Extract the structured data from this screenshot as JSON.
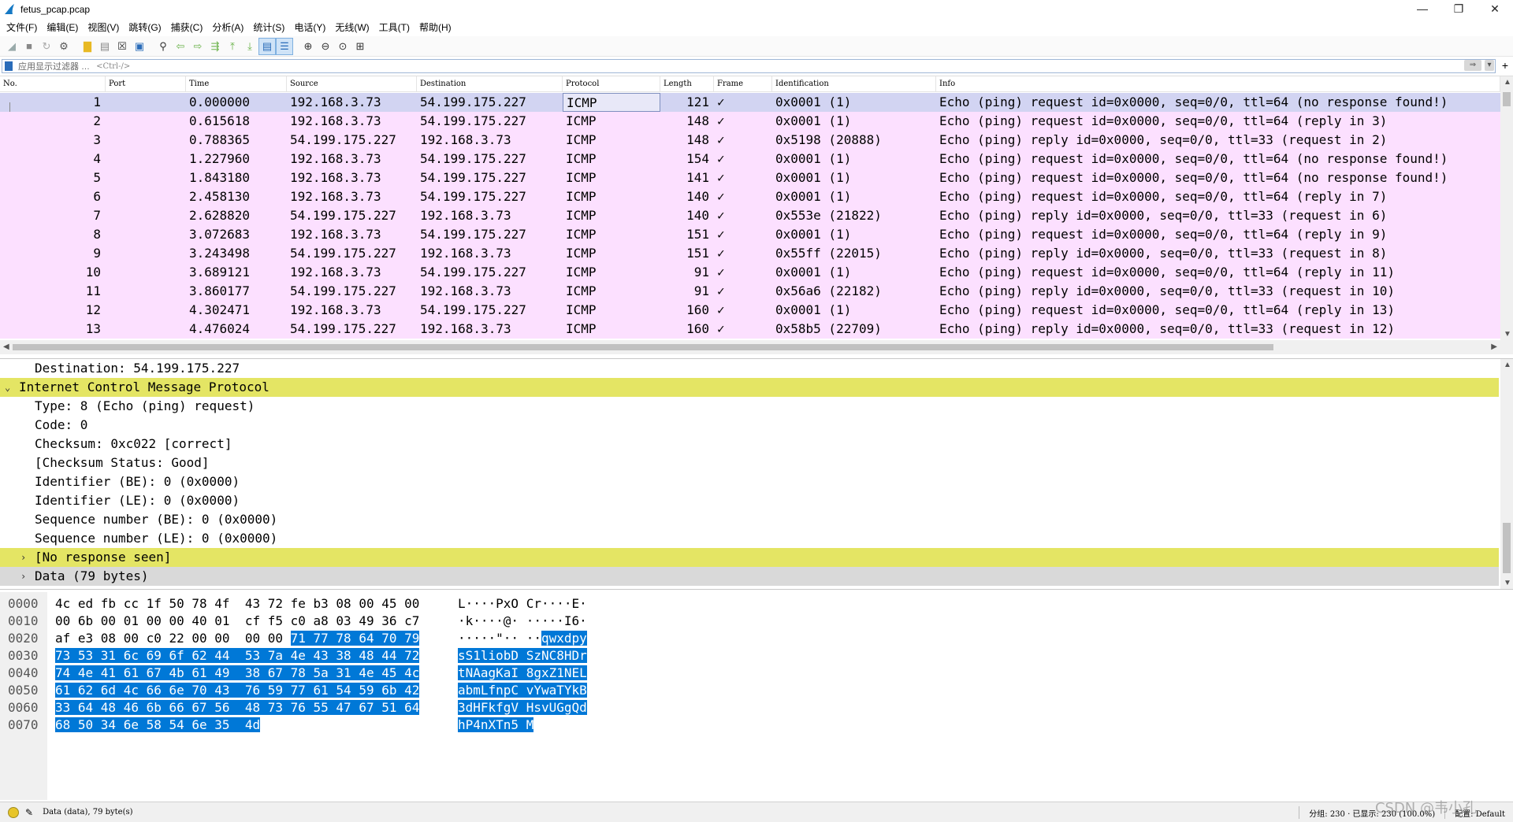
{
  "window": {
    "title": "fetus_pcap.pcap",
    "controls": [
      "—",
      "❐",
      "✕"
    ]
  },
  "menu": [
    "文件(F)",
    "编辑(E)",
    "视图(V)",
    "跳转(G)",
    "捕获(C)",
    "分析(A)",
    "统计(S)",
    "电话(Y)",
    "无线(W)",
    "工具(T)",
    "帮助(H)"
  ],
  "filter": {
    "placeholder": "应用显示过滤器 … <Ctrl-/>",
    "label": "应用显示过滤器 …",
    "hint": "<Ctrl-/>",
    "plus": "+"
  },
  "columns": [
    "No.",
    "Port",
    "Time",
    "Source",
    "Destination",
    "Protocol",
    "Length",
    "Frame",
    "Identification",
    "Info"
  ],
  "packets": [
    {
      "no": "1",
      "time": "0.000000",
      "src": "192.168.3.73",
      "dst": "54.199.175.227",
      "proto": "ICMP",
      "len": "121",
      "frame": "✓",
      "ident": "0x0001 (1)",
      "info": "Echo (ping) request  id=0x0000, seq=0/0, ttl=64 (no response found!)"
    },
    {
      "no": "2",
      "time": "0.615618",
      "src": "192.168.3.73",
      "dst": "54.199.175.227",
      "proto": "ICMP",
      "len": "148",
      "frame": "✓",
      "ident": "0x0001 (1)",
      "info": "Echo (ping) request  id=0x0000, seq=0/0, ttl=64 (reply in 3)"
    },
    {
      "no": "3",
      "time": "0.788365",
      "src": "54.199.175.227",
      "dst": "192.168.3.73",
      "proto": "ICMP",
      "len": "148",
      "frame": "✓",
      "ident": "0x5198 (20888)",
      "info": "Echo (ping) reply    id=0x0000, seq=0/0, ttl=33 (request in 2)"
    },
    {
      "no": "4",
      "time": "1.227960",
      "src": "192.168.3.73",
      "dst": "54.199.175.227",
      "proto": "ICMP",
      "len": "154",
      "frame": "✓",
      "ident": "0x0001 (1)",
      "info": "Echo (ping) request  id=0x0000, seq=0/0, ttl=64 (no response found!)"
    },
    {
      "no": "5",
      "time": "1.843180",
      "src": "192.168.3.73",
      "dst": "54.199.175.227",
      "proto": "ICMP",
      "len": "141",
      "frame": "✓",
      "ident": "0x0001 (1)",
      "info": "Echo (ping) request  id=0x0000, seq=0/0, ttl=64 (no response found!)"
    },
    {
      "no": "6",
      "time": "2.458130",
      "src": "192.168.3.73",
      "dst": "54.199.175.227",
      "proto": "ICMP",
      "len": "140",
      "frame": "✓",
      "ident": "0x0001 (1)",
      "info": "Echo (ping) request  id=0x0000, seq=0/0, ttl=64 (reply in 7)"
    },
    {
      "no": "7",
      "time": "2.628820",
      "src": "54.199.175.227",
      "dst": "192.168.3.73",
      "proto": "ICMP",
      "len": "140",
      "frame": "✓",
      "ident": "0x553e (21822)",
      "info": "Echo (ping) reply    id=0x0000, seq=0/0, ttl=33 (request in 6)"
    },
    {
      "no": "8",
      "time": "3.072683",
      "src": "192.168.3.73",
      "dst": "54.199.175.227",
      "proto": "ICMP",
      "len": "151",
      "frame": "✓",
      "ident": "0x0001 (1)",
      "info": "Echo (ping) request  id=0x0000, seq=0/0, ttl=64 (reply in 9)"
    },
    {
      "no": "9",
      "time": "3.243498",
      "src": "54.199.175.227",
      "dst": "192.168.3.73",
      "proto": "ICMP",
      "len": "151",
      "frame": "✓",
      "ident": "0x55ff (22015)",
      "info": "Echo (ping) reply    id=0x0000, seq=0/0, ttl=33 (request in 8)"
    },
    {
      "no": "10",
      "time": "3.689121",
      "src": "192.168.3.73",
      "dst": "54.199.175.227",
      "proto": "ICMP",
      "len": "91",
      "frame": "✓",
      "ident": "0x0001 (1)",
      "info": "Echo (ping) request  id=0x0000, seq=0/0, ttl=64 (reply in 11)"
    },
    {
      "no": "11",
      "time": "3.860177",
      "src": "54.199.175.227",
      "dst": "192.168.3.73",
      "proto": "ICMP",
      "len": "91",
      "frame": "✓",
      "ident": "0x56a6 (22182)",
      "info": "Echo (ping) reply    id=0x0000, seq=0/0, ttl=33 (request in 10)"
    },
    {
      "no": "12",
      "time": "4.302471",
      "src": "192.168.3.73",
      "dst": "54.199.175.227",
      "proto": "ICMP",
      "len": "160",
      "frame": "✓",
      "ident": "0x0001 (1)",
      "info": "Echo (ping) request  id=0x0000, seq=0/0, ttl=64 (reply in 13)"
    },
    {
      "no": "13",
      "time": "4.476024",
      "src": "54.199.175.227",
      "dst": "192.168.3.73",
      "proto": "ICMP",
      "len": "160",
      "frame": "✓",
      "ident": "0x58b5 (22709)",
      "info": "Echo (ping) reply    id=0x0000, seq=0/0, ttl=33 (request in 12)"
    }
  ],
  "details": [
    {
      "text": "Destination: 54.199.175.227",
      "level": 1,
      "toggle": "",
      "style": ""
    },
    {
      "text": "Internet Control Message Protocol",
      "level": 0,
      "toggle": "⌄",
      "style": "hl"
    },
    {
      "text": "Type: 8 (Echo (ping) request)",
      "level": 1,
      "toggle": "",
      "style": ""
    },
    {
      "text": "Code: 0",
      "level": 1,
      "toggle": "",
      "style": ""
    },
    {
      "text": "Checksum: 0xc022 [correct]",
      "level": 1,
      "toggle": "",
      "style": ""
    },
    {
      "text": "[Checksum Status: Good]",
      "level": 1,
      "toggle": "",
      "style": ""
    },
    {
      "text": "Identifier (BE): 0 (0x0000)",
      "level": 1,
      "toggle": "",
      "style": ""
    },
    {
      "text": "Identifier (LE): 0 (0x0000)",
      "level": 1,
      "toggle": "",
      "style": ""
    },
    {
      "text": "Sequence number (BE): 0 (0x0000)",
      "level": 1,
      "toggle": "",
      "style": ""
    },
    {
      "text": "Sequence number (LE): 0 (0x0000)",
      "level": 1,
      "toggle": "",
      "style": ""
    },
    {
      "text": "[No response seen]",
      "level": 1,
      "toggle": "›",
      "style": "hl"
    },
    {
      "text": "Data (79 bytes)",
      "level": 1,
      "toggle": "›",
      "style": "gray"
    }
  ],
  "hex": [
    {
      "off": "0000",
      "bytes_plain": "4c ed fb cc 1f 50 78 4f  43 72 fe b3 08 00 45 00",
      "bytes_sel": "",
      "ascii_plain": "L····PxO Cr····E·",
      "ascii_sel": ""
    },
    {
      "off": "0010",
      "bytes_plain": "00 6b 00 01 00 00 40 01  cf f5 c0 a8 03 49 36 c7",
      "bytes_sel": "",
      "ascii_plain": "·k····@· ·····I6·",
      "ascii_sel": ""
    },
    {
      "off": "0020",
      "bytes_plain": "af e3 08 00 c0 22 00 00  00 00 ",
      "bytes_sel": "71 77 78 64 70 79",
      "ascii_plain": "·····\"·· ··",
      "ascii_sel": "qwxdpy"
    },
    {
      "off": "0030",
      "bytes_plain": "",
      "bytes_sel": "73 53 31 6c 69 6f 62 44  53 7a 4e 43 38 48 44 72",
      "ascii_plain": "",
      "ascii_sel": "sS1liobD SzNC8HDr"
    },
    {
      "off": "0040",
      "bytes_plain": "",
      "bytes_sel": "74 4e 41 61 67 4b 61 49  38 67 78 5a 31 4e 45 4c",
      "ascii_plain": "",
      "ascii_sel": "tNAagKaI 8gxZ1NEL"
    },
    {
      "off": "0050",
      "bytes_plain": "",
      "bytes_sel": "61 62 6d 4c 66 6e 70 43  76 59 77 61 54 59 6b 42",
      "ascii_plain": "",
      "ascii_sel": "abmLfnpC vYwaTYkB"
    },
    {
      "off": "0060",
      "bytes_plain": "",
      "bytes_sel": "33 64 48 46 6b 66 67 56  48 73 76 55 47 67 51 64",
      "ascii_plain": "",
      "ascii_sel": "3dHFkfgV HsvUGgQd"
    },
    {
      "off": "0070",
      "bytes_plain": "",
      "bytes_sel": "68 50 34 6e 58 54 6e 35  4d",
      "ascii_plain": "",
      "ascii_sel": "hP4nXTn5 M"
    }
  ],
  "status": {
    "left": "Data (data), 79 byte(s)",
    "packets": "分组: 230 · 已显示: 230 (100.0%)",
    "profile": "配置: Default"
  },
  "watermark": "CSDN @韦小孔",
  "colors": {
    "row_bg": "#fce0ff",
    "selected_bg": "#d2d4f2",
    "highlight": "#e4e564",
    "hex_select": "#0078d7"
  }
}
